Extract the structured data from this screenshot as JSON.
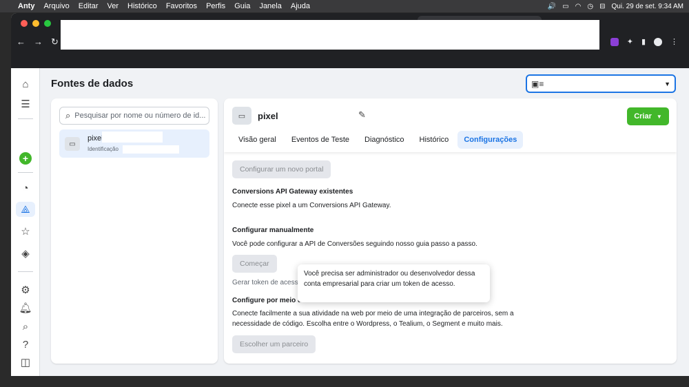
{
  "menubar": {
    "app": "Anty",
    "items": [
      "Arquivo",
      "Editar",
      "Ver",
      "Histórico",
      "Favoritos",
      "Perfis",
      "Guia",
      "Janela",
      "Ajuda"
    ],
    "datetime": "Qui. 29 de set.  9:34 AM"
  },
  "page": {
    "title": "Fontes de dados"
  },
  "search": {
    "placeholder": "Pesquisar por nome ou número de id..."
  },
  "datasource": {
    "name": "pixel",
    "id_label": "Identificação"
  },
  "header": {
    "pixel_name": "pixel",
    "create_label": "Criar"
  },
  "tabs": [
    {
      "label": "Visão geral"
    },
    {
      "label": "Eventos de Teste"
    },
    {
      "label": "Diagnóstico"
    },
    {
      "label": "Histórico"
    },
    {
      "label": "Configurações",
      "active": true
    }
  ],
  "content": {
    "new_portal_button": "Configurar um novo portal",
    "gateway_title": "Conversions API Gateway existentes",
    "gateway_text": "Conecte esse pixel a um Conversions API Gateway.",
    "manual_title": "Configurar manualmente",
    "manual_text": "Você pode configurar a API de Conversões seguindo nosso guia passo a passo.",
    "start_button": "Começar",
    "token_link": "Gerar token de acesso",
    "partner_title": "Configure por meio de u",
    "partner_text_1": "Conecte facilmente a sua atividade na web por meio de uma integração de parceiros, sem a",
    "partner_text_2": "necessidade de código. Escolha entre o Wordpress, o Tealium, o Segment e muito mais.",
    "partner_button": "Escolher um parceiro"
  },
  "tooltip": {
    "text": "Você precisa ser administrador ou desenvolvedor dessa conta empresarial para criar um token de acesso."
  },
  "colors": {
    "accent": "#1b74e4",
    "create": "#42b72a"
  },
  "icons": {
    "rail": [
      "home-icon",
      "menu-icon",
      "add-icon",
      "dashboard-icon",
      "data-sources-icon",
      "star-icon",
      "partner-icon",
      "settings-icon",
      "notifications-icon",
      "search-icon",
      "help-icon",
      "panel-icon"
    ]
  }
}
